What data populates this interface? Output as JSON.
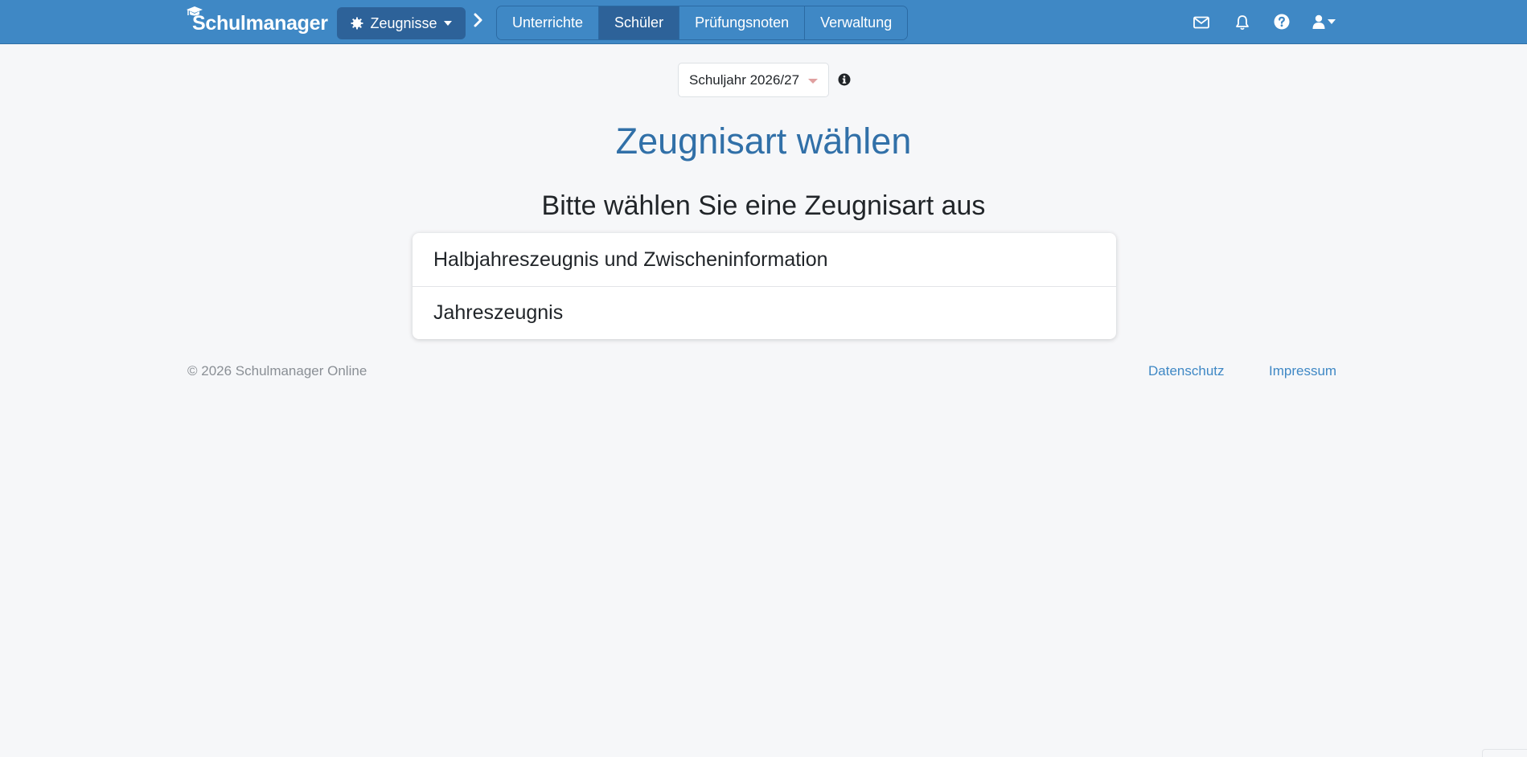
{
  "navbar": {
    "brand": "Schulmanager",
    "module_button": "Zeugnisse",
    "nav_items": [
      {
        "label": "Unterrichte",
        "active": false
      },
      {
        "label": "Schüler",
        "active": true
      },
      {
        "label": "Prüfungsnoten",
        "active": false
      },
      {
        "label": "Verwaltung",
        "active": false
      }
    ],
    "icons": [
      "mail-icon",
      "bell-icon",
      "help-icon",
      "user-icon"
    ]
  },
  "year_select": {
    "value": "Schuljahr 2026/27"
  },
  "main": {
    "title": "Zeugnisart wählen",
    "subtitle": "Bitte wählen Sie eine Zeugnisart aus",
    "options": [
      {
        "label": "Halbjahreszeugnis und Zwischeninformation"
      },
      {
        "label": "Jahreszeugnis"
      }
    ]
  },
  "footer": {
    "copyright": "© 2026 Schulmanager Online",
    "links": [
      {
        "label": "Datenschutz"
      },
      {
        "label": "Impressum"
      }
    ]
  },
  "colors": {
    "navbar": "#3f88c5",
    "navbar_active": "#2d6299",
    "title": "#3170a8",
    "link": "#3f88c5",
    "background": "#f6f7f9"
  }
}
